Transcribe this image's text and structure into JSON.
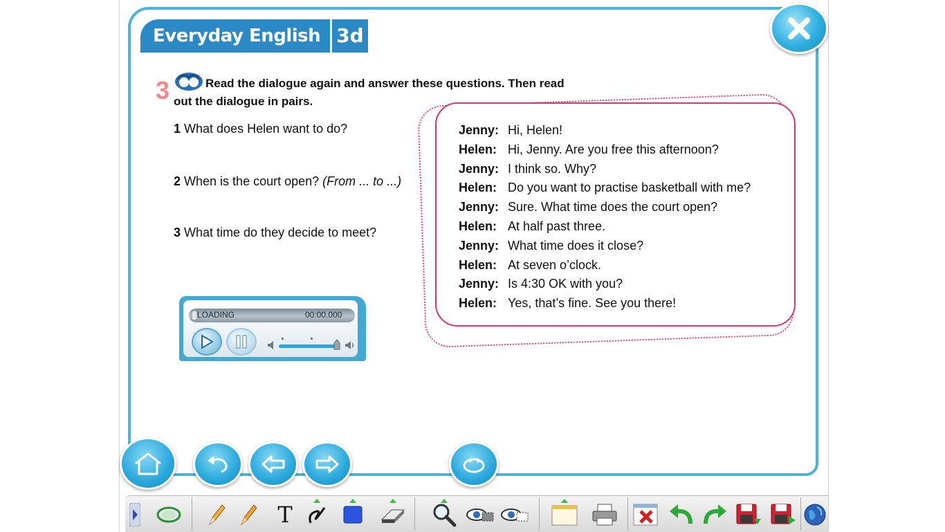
{
  "header": {
    "title": "Everyday English",
    "unit": "3d"
  },
  "exercise": {
    "number": "3",
    "instruction_line1": "Read the dialogue again and answer these questions. Then read",
    "instruction_line2": "out the dialogue in pairs."
  },
  "questions": [
    {
      "number": "1",
      "text": "What does Helen want to do?",
      "hint": ""
    },
    {
      "number": "2",
      "text": "When is the court open?",
      "hint": "(From ... to ...)"
    },
    {
      "number": "3",
      "text": "What time do they decide to meet?",
      "hint": ""
    }
  ],
  "player": {
    "status": "LOADING",
    "time": "00:00.000",
    "progress": 0
  },
  "dialogue": [
    {
      "speaker": "Jenny:",
      "line": "Hi, Helen!"
    },
    {
      "speaker": "Helen:",
      "line": "Hi, Jenny. Are you free this afternoon?"
    },
    {
      "speaker": "Jenny:",
      "line": "I think so. Why?"
    },
    {
      "speaker": "Helen:",
      "line": "Do you want to practise basketball with me?"
    },
    {
      "speaker": "Jenny:",
      "line": "Sure. What time does the court open?"
    },
    {
      "speaker": "Helen:",
      "line": "At half past three."
    },
    {
      "speaker": "Jenny:",
      "line": "What time does it close?"
    },
    {
      "speaker": "Helen:",
      "line": "At seven o’clock."
    },
    {
      "speaker": "Jenny:",
      "line": "Is 4:30 OK with you?"
    },
    {
      "speaker": "Helen:",
      "line": "Yes, that’s fine. See you there!"
    }
  ],
  "colors": {
    "accent_blue": "#2b8ac6",
    "frame_blue": "#4db3d9",
    "dialogue_pink": "#d83571",
    "exercise_number": "#f08a8a"
  },
  "nav_icons": [
    "home-icon",
    "undo-icon",
    "previous-arrow-icon",
    "next-arrow-icon",
    "refresh-icon",
    "close-icon"
  ],
  "toolbar_icons": [
    "expand-toolbar-icon",
    "mouse-pointer-icon",
    "pencil-icon",
    "highlighter-icon",
    "text-icon",
    "freehand-icon",
    "rectangle-icon",
    "eraser-icon",
    "zoom-icon",
    "spotlight-icon",
    "hide-screen-icon",
    "blank-page-icon",
    "print-icon",
    "clear-all-icon",
    "undo-icon",
    "redo-icon",
    "save-icon",
    "save-as-icon",
    "web-icon"
  ],
  "toolbar": {
    "text_tool_label": "T"
  }
}
